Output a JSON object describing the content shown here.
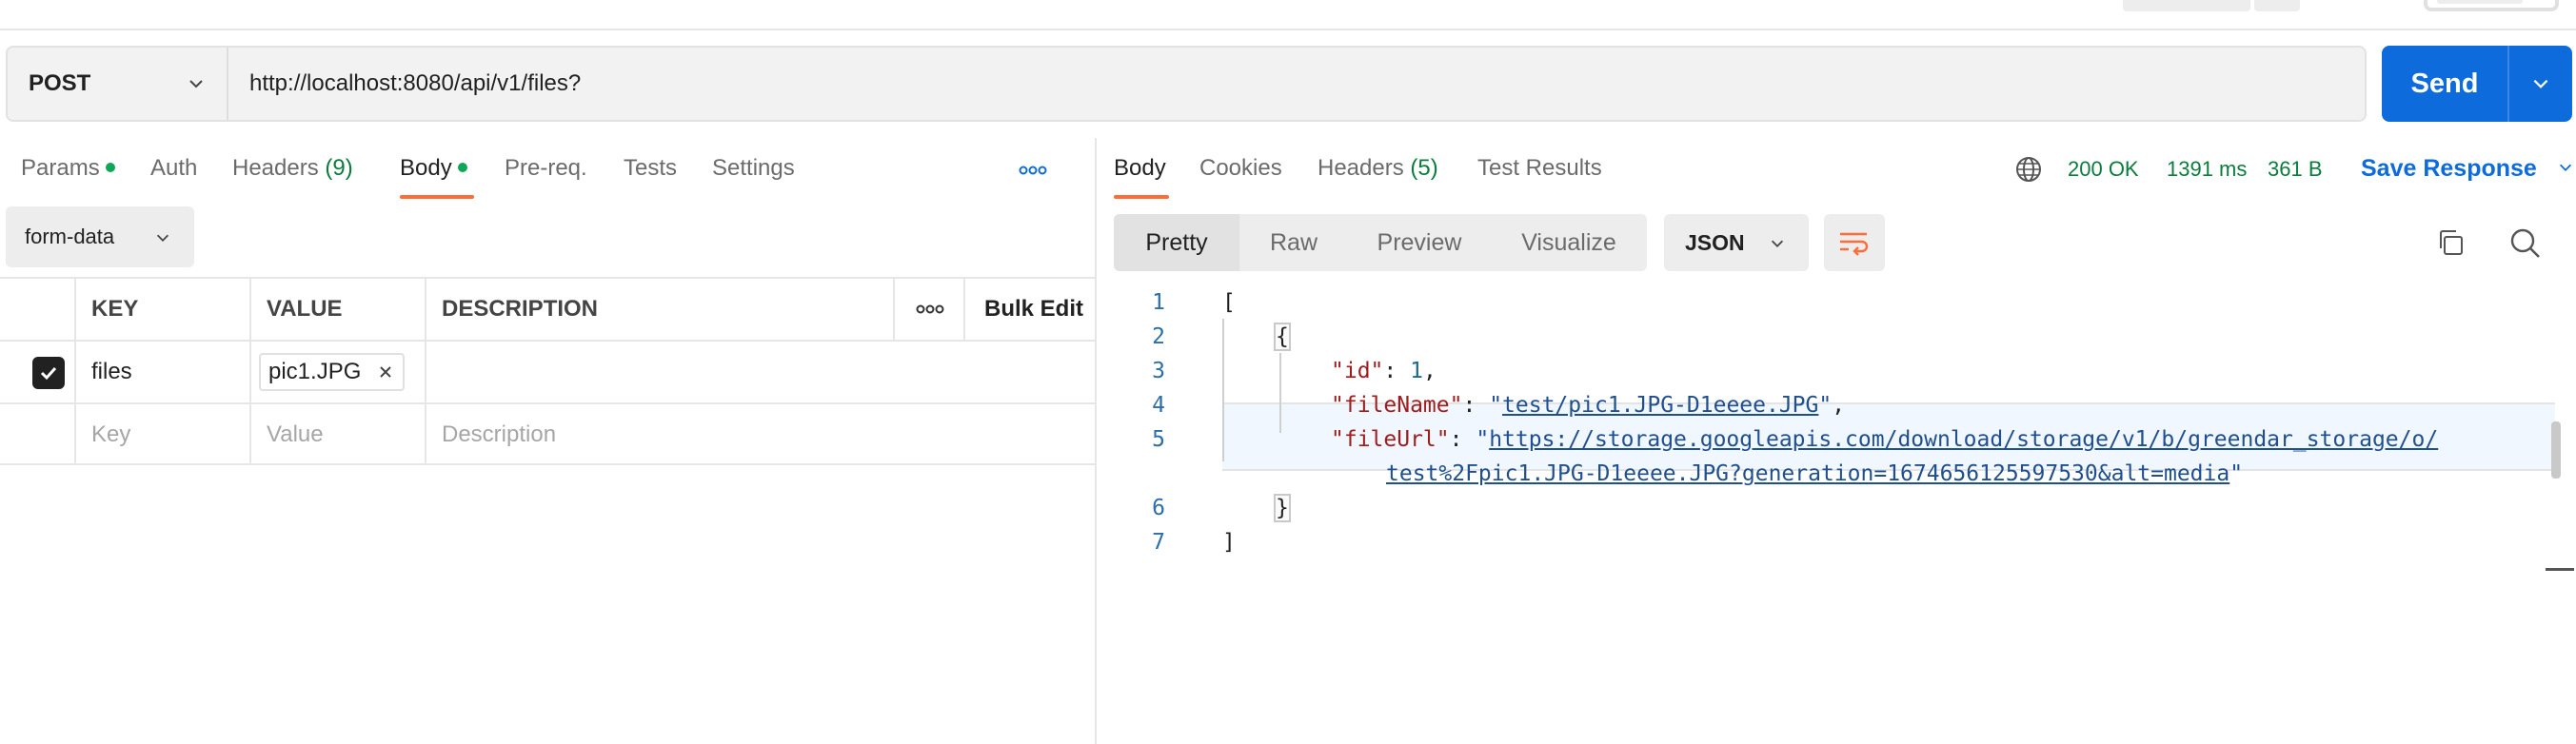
{
  "request": {
    "method": "POST",
    "url": "http://localhost:8080/api/v1/files?",
    "send_label": "Send"
  },
  "request_tabs": [
    {
      "label": "Params",
      "dot": true
    },
    {
      "label": "Auth"
    },
    {
      "label": "Headers",
      "count": "(9)"
    },
    {
      "label": "Body",
      "dot": true,
      "active": true
    },
    {
      "label": "Pre-req."
    },
    {
      "label": "Tests"
    },
    {
      "label": "Settings"
    }
  ],
  "body_mode": "form-data",
  "form_table": {
    "headers": {
      "key": "KEY",
      "value": "VALUE",
      "description": "DESCRIPTION",
      "bulk_edit": "Bulk Edit"
    },
    "rows": [
      {
        "checked": true,
        "key": "files",
        "value": "pic1.JPG",
        "description": ""
      }
    ],
    "placeholders": {
      "key": "Key",
      "value": "Value",
      "description": "Description"
    }
  },
  "response_tabs": [
    {
      "label": "Body",
      "active": true
    },
    {
      "label": "Cookies"
    },
    {
      "label": "Headers",
      "count": "(5)"
    },
    {
      "label": "Test Results"
    }
  ],
  "response_status": {
    "code": "200 OK",
    "time": "1391 ms",
    "size": "361 B"
  },
  "save_response_label": "Save Response",
  "view_modes": [
    "Pretty",
    "Raw",
    "Preview",
    "Visualize"
  ],
  "active_view": "Pretty",
  "format": "JSON",
  "code_lines": {
    "n1": "1",
    "n2": "2",
    "n3": "3",
    "n4": "4",
    "n5": "5",
    "n6": "6",
    "n7": "7",
    "open_array": "[",
    "open_obj": "{",
    "id_key": "\"id\"",
    "id_val": "1",
    "filename_key": "\"fileName\"",
    "filename_val_q": "\"",
    "filename_val": "test/pic1.JPG-D1eeee.JPG",
    "fileurl_key": "\"fileUrl\"",
    "fileurl_val_part1": "https://storage.googleapis.com/download/storage/v1/b/greendar_storage/o/",
    "fileurl_val_part2": "test%2Fpic1.JPG-D1eeee.JPG?generation=1674656125597530&alt=media",
    "close_obj": "}",
    "close_array": "]"
  },
  "colors": {
    "accent": "#0e6bdc",
    "status_green": "#0a7d3c",
    "tab_underline": "#ff6c37"
  },
  "icons": [
    "chevron-down-icon",
    "more-horizontal-icon",
    "globe-icon",
    "wrap-lines-icon",
    "copy-icon",
    "search-icon",
    "checkmark-icon",
    "close-icon"
  ]
}
